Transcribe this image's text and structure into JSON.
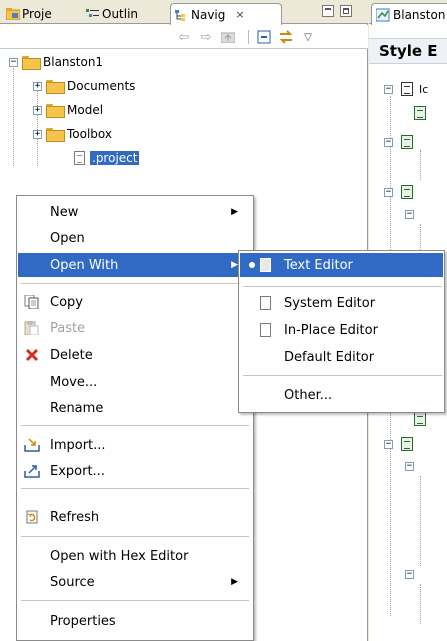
{
  "left_tabs": [
    {
      "label": "Proje",
      "icon": "project-explorer-icon"
    },
    {
      "label": "Outlin",
      "icon": "outline-icon"
    },
    {
      "label": "Navig",
      "icon": "navigator-icon",
      "close": "×"
    }
  ],
  "tree": {
    "root": "Blanston1",
    "children": [
      "Documents",
      "Model",
      "Toolbox"
    ],
    "selected_file": ".project"
  },
  "editor": {
    "tab_label": "Blanston",
    "heading": "Style E",
    "first_node": "Ic"
  },
  "context_menu": {
    "items": {
      "new": "New",
      "open": "Open",
      "open_with": "Open With",
      "copy": "Copy",
      "paste": "Paste",
      "delete": "Delete",
      "move": "Move...",
      "rename": "Rename",
      "import": "Import...",
      "export": "Export...",
      "refresh": "Refresh",
      "open_hex": "Open with Hex Editor",
      "source": "Source",
      "properties": "Properties"
    }
  },
  "submenu": {
    "text_editor": "Text Editor",
    "system_editor": "System Editor",
    "inplace_editor": "In-Place Editor",
    "default_editor": "Default Editor",
    "other": "Other..."
  },
  "colors": {
    "selection": "#316ac5",
    "chrome": "#ece9d8",
    "folder": "#f5c54a",
    "delete": "#d62b1f"
  }
}
